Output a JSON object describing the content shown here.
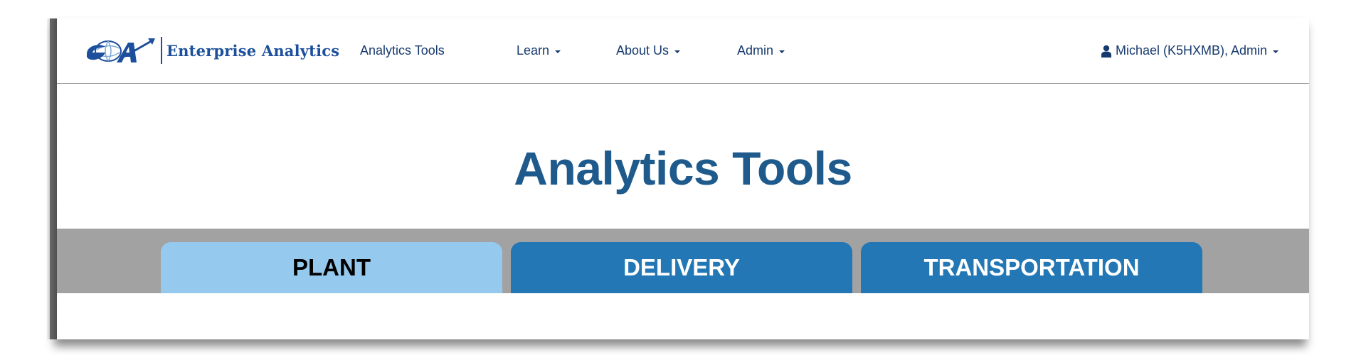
{
  "brand": {
    "name": "Enterprise Analytics",
    "logo_icon": "ea-globe-arrow-logo"
  },
  "nav": {
    "items": [
      {
        "label": "Analytics Tools",
        "has_dropdown": false
      },
      {
        "label": "Learn",
        "has_dropdown": true
      },
      {
        "label": "About Us",
        "has_dropdown": true
      },
      {
        "label": "Admin",
        "has_dropdown": true
      }
    ],
    "user": {
      "label": "Michael (K5HXMB), Admin",
      "icon": "user-icon",
      "has_dropdown": true
    }
  },
  "main": {
    "title": "Analytics Tools",
    "tabs": [
      {
        "label": "PLANT",
        "active": true
      },
      {
        "label": "DELIVERY",
        "active": false
      },
      {
        "label": "TRANSPORTATION",
        "active": false
      }
    ]
  },
  "colors": {
    "brand_blue": "#1c4f9c",
    "title_blue": "#1f5a8c",
    "tab_active": "#95c9ee",
    "tab_inactive": "#2277b4",
    "tab_strip": "#a2a2a2",
    "nav_text": "#163a6e"
  }
}
